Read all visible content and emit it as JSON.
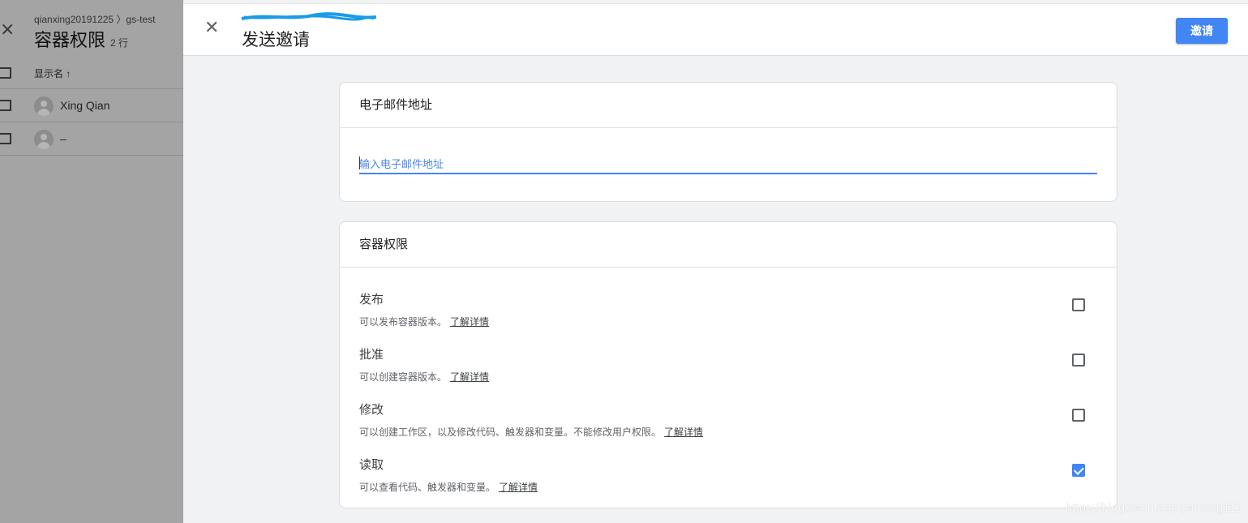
{
  "background": {
    "breadcrumb": "qianxing20191225 〉gs-test",
    "title": "容器权限",
    "row_count": "2 行",
    "column_header": "显示名 ↑",
    "rows": [
      {
        "name": "Xing Qian"
      },
      {
        "name": "–"
      }
    ]
  },
  "dialog": {
    "title": "发送邀请",
    "invite_label": "邀请",
    "email_section": {
      "title": "电子邮件地址",
      "placeholder": "输入电子邮件地址"
    },
    "permissions_section": {
      "title": "容器权限",
      "items": [
        {
          "name": "发布",
          "desc": "可以发布容器版本。",
          "link": "了解详情",
          "checked": false
        },
        {
          "name": "批准",
          "desc": "可以创建容器版本。",
          "link": "了解详情",
          "checked": false
        },
        {
          "name": "修改",
          "desc": "可以创建工作区，以及修改代码、触发器和变量。不能修改用户权限。",
          "link": "了解详情",
          "checked": false
        },
        {
          "name": "读取",
          "desc": "可以查看代码、触发器和变量。",
          "link": "了解详情",
          "checked": true
        }
      ]
    },
    "accent_color": "#4285f4"
  },
  "watermark": "https://blog.csdn.net/qianxing111"
}
